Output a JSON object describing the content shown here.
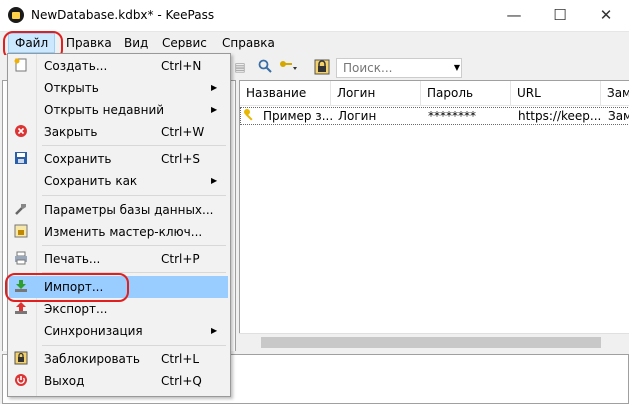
{
  "window": {
    "title": "NewDatabase.kdbx* - KeePass"
  },
  "winbuttons": {
    "minimize": "—",
    "maximize": "☐",
    "close": "✕"
  },
  "menubar": [
    "Файл",
    "Правка",
    "Вид",
    "Сервис",
    "Справка"
  ],
  "toolbar": {
    "search_placeholder": "Поиск..."
  },
  "file_menu": {
    "items": [
      {
        "label": "Создать...",
        "shortcut": "Ctrl+N",
        "icon": "new-db-icon"
      },
      {
        "label": "Открыть",
        "submenu": true
      },
      {
        "label": "Открыть недавний",
        "submenu": true
      },
      {
        "label": "Закрыть",
        "shortcut": "Ctrl+W",
        "icon": "close-db-icon"
      },
      {
        "label": "Сохранить",
        "shortcut": "Ctrl+S",
        "icon": "save-icon"
      },
      {
        "label": "Сохранить как",
        "submenu": true
      },
      {
        "label": "Параметры базы данных...",
        "icon": "db-settings-icon"
      },
      {
        "label": "Изменить мастер-ключ...",
        "icon": "master-key-icon"
      },
      {
        "label": "Печать...",
        "shortcut": "Ctrl+P",
        "icon": "print-icon"
      },
      {
        "label": "Импорт...",
        "icon": "import-icon",
        "highlighted": true
      },
      {
        "label": "Экспорт...",
        "icon": "export-icon"
      },
      {
        "label": "Синхронизация",
        "submenu": true
      },
      {
        "label": "Заблокировать",
        "shortcut": "Ctrl+L",
        "icon": "lock-icon"
      },
      {
        "label": "Выход",
        "shortcut": "Ctrl+Q",
        "icon": "exit-icon"
      }
    ]
  },
  "entries_table": {
    "columns": [
      "Название",
      "Логин",
      "Пароль",
      "URL",
      "Зам"
    ],
    "rows": [
      {
        "title": "Пример з...",
        "login": "Логин",
        "password": "********",
        "url": "https://keep...",
        "notes": "Зам"
      }
    ]
  },
  "colors": {
    "menu_highlight": "#99ccff",
    "callout": "#e02020"
  }
}
